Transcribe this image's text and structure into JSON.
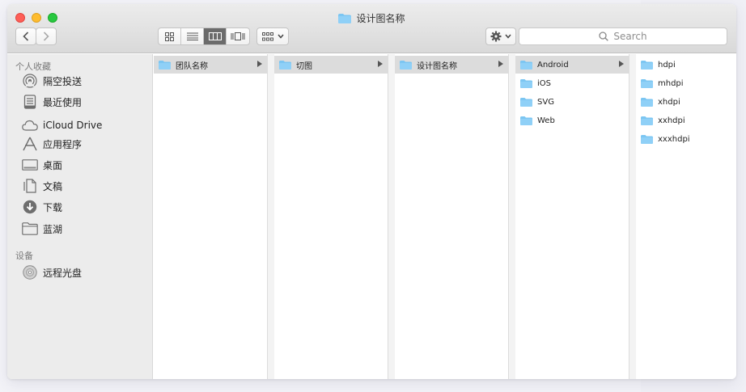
{
  "window": {
    "title": "设计图名称"
  },
  "toolbar": {
    "search_placeholder": "Search"
  },
  "sidebar": {
    "favorites_header": "个人收藏",
    "favorites": [
      {
        "label": "隔空投送",
        "icon": "airdrop-icon"
      },
      {
        "label": "最近使用",
        "icon": "recents-icon"
      },
      {
        "label": "iCloud Drive",
        "icon": "cloud-icon"
      },
      {
        "label": "应用程序",
        "icon": "applications-icon"
      },
      {
        "label": "桌面",
        "icon": "desktop-icon"
      },
      {
        "label": "文稿",
        "icon": "documents-icon"
      },
      {
        "label": "下载",
        "icon": "downloads-icon"
      },
      {
        "label": "蓝湖",
        "icon": "folder-icon"
      }
    ],
    "devices_header": "设备",
    "devices": [
      {
        "label": "远程光盘",
        "icon": "disc-icon"
      }
    ]
  },
  "columns": [
    {
      "items": [
        {
          "label": "团队名称",
          "selected": true,
          "has_children": true
        }
      ]
    },
    {
      "items": [
        {
          "label": "切图",
          "selected": true,
          "has_children": true
        }
      ]
    },
    {
      "items": [
        {
          "label": "设计图名称",
          "selected": true,
          "has_children": true
        }
      ]
    },
    {
      "items": [
        {
          "label": "Android",
          "selected": true,
          "has_children": true
        },
        {
          "label": "iOS",
          "selected": false,
          "has_children": false
        },
        {
          "label": "SVG",
          "selected": false,
          "has_children": false
        },
        {
          "label": "Web",
          "selected": false,
          "has_children": false
        }
      ]
    },
    {
      "items": [
        {
          "label": "hdpi",
          "selected": false,
          "has_children": false
        },
        {
          "label": "mhdpi",
          "selected": false,
          "has_children": false
        },
        {
          "label": "xhdpi",
          "selected": false,
          "has_children": false
        },
        {
          "label": "xxhdpi",
          "selected": false,
          "has_children": false
        },
        {
          "label": "xxxhdpi",
          "selected": false,
          "has_children": false
        }
      ]
    }
  ],
  "colors": {
    "folder": "#7cc6f2",
    "selection": "#dcdcdc",
    "active_view": "#6b6b6b"
  }
}
